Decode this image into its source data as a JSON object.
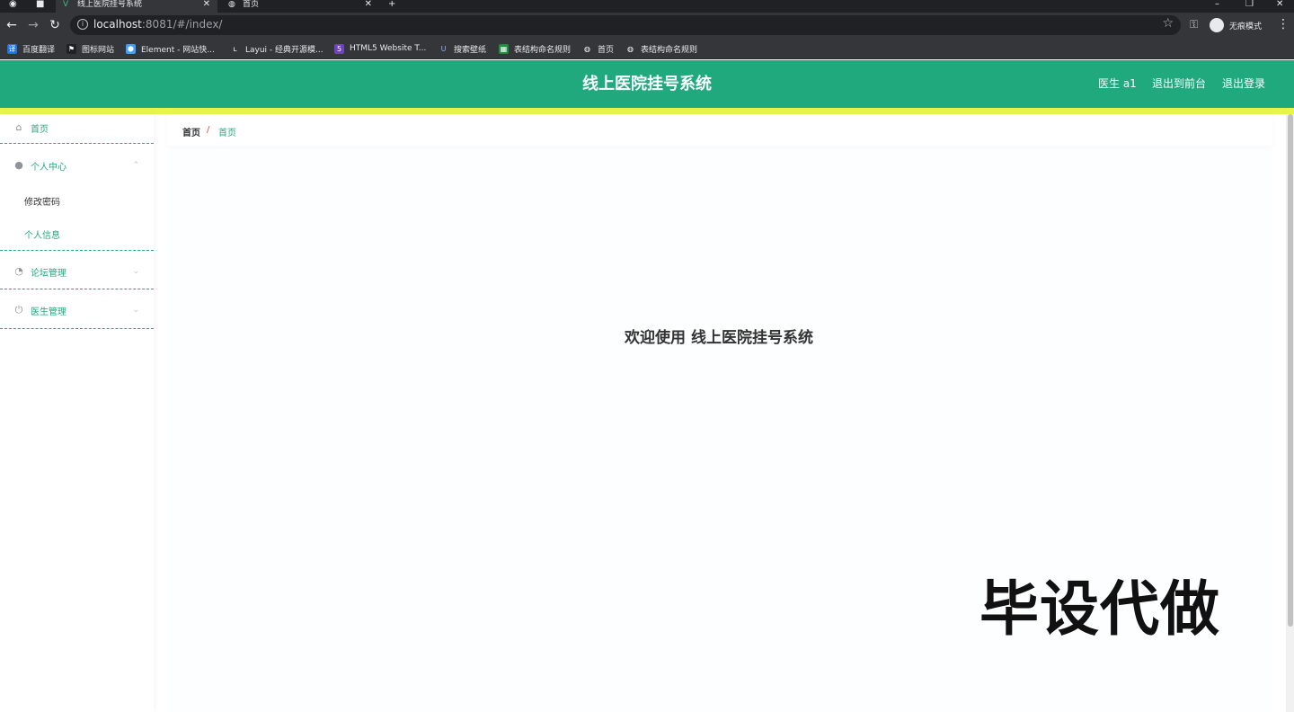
{
  "browser": {
    "tabs": [
      {
        "label": "线上医院挂号系统",
        "icon": "vue-icon",
        "active": true
      },
      {
        "label": "首页",
        "icon": "globe-icon",
        "active": false
      }
    ],
    "new_tab_symbol": "+",
    "url_host": "localhost",
    "url_rest": ":8081/#/index/",
    "incognito_label": "无痕模式",
    "bookmarks": [
      {
        "label": "百度翻译",
        "icon": "translate-icon",
        "color": "#1a73e8"
      },
      {
        "label": "图标网站",
        "icon": "flag-icon",
        "color": "#202124"
      },
      {
        "label": "Element - 网站快...",
        "icon": "element-icon",
        "color": "#409eff"
      },
      {
        "label": "Layui - 经典开源模...",
        "icon": "layui-icon",
        "color": "#35363a"
      },
      {
        "label": "HTML5 Website T...",
        "icon": "html5-icon",
        "color": "#6f42c1"
      },
      {
        "label": "搜索壁纸",
        "icon": "wallpaper-icon",
        "color": "#35363a"
      },
      {
        "label": "表结构命名规则",
        "icon": "table-icon",
        "color": "#1e8e3e"
      },
      {
        "label": "首页",
        "icon": "globe-icon",
        "color": "#35363a"
      },
      {
        "label": "表结构命名规则",
        "icon": "globe-icon",
        "color": "#35363a"
      }
    ]
  },
  "header": {
    "title": "线上医院挂号系统",
    "user": "医生 a1",
    "to_frontend": "退出到前台",
    "logout": "退出登录"
  },
  "sidebar": {
    "home": "首页",
    "personal_center": "个人中心",
    "change_password": "修改密码",
    "personal_info": "个人信息",
    "forum_mgmt": "论坛管理",
    "doctor_mgmt": "医生管理"
  },
  "breadcrumb": {
    "root": "首页",
    "separator": "/",
    "current": "首页"
  },
  "main": {
    "welcome": "欢迎使用 线上医院挂号系统"
  },
  "watermark": "毕设代做",
  "colors": {
    "primary": "#21a97e",
    "accent_strip": "#e9f34e",
    "breadcrumb_separator": "#e0443e"
  }
}
